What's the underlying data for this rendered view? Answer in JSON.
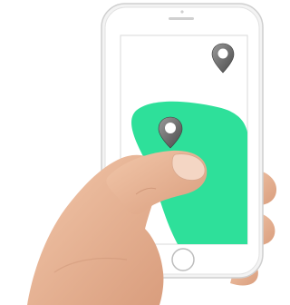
{
  "scene": {
    "subject": "hand-holding-smartphone",
    "device": {
      "body_color": "#f3f3f3",
      "bezel_color": "#ffffff",
      "outline_color": "#cfcfcf",
      "home_button": "circle"
    },
    "screen": {
      "background": "#ffffff",
      "zone_color": "#2ee09a",
      "pins": [
        {
          "icon": "map-pin-icon",
          "color": "#6b6b6b"
        },
        {
          "icon": "map-pin-icon",
          "color": "#6b6b6b"
        }
      ]
    },
    "hand": {
      "skin_color": "#e9b99b",
      "shadow_color": "#c98f70"
    }
  }
}
